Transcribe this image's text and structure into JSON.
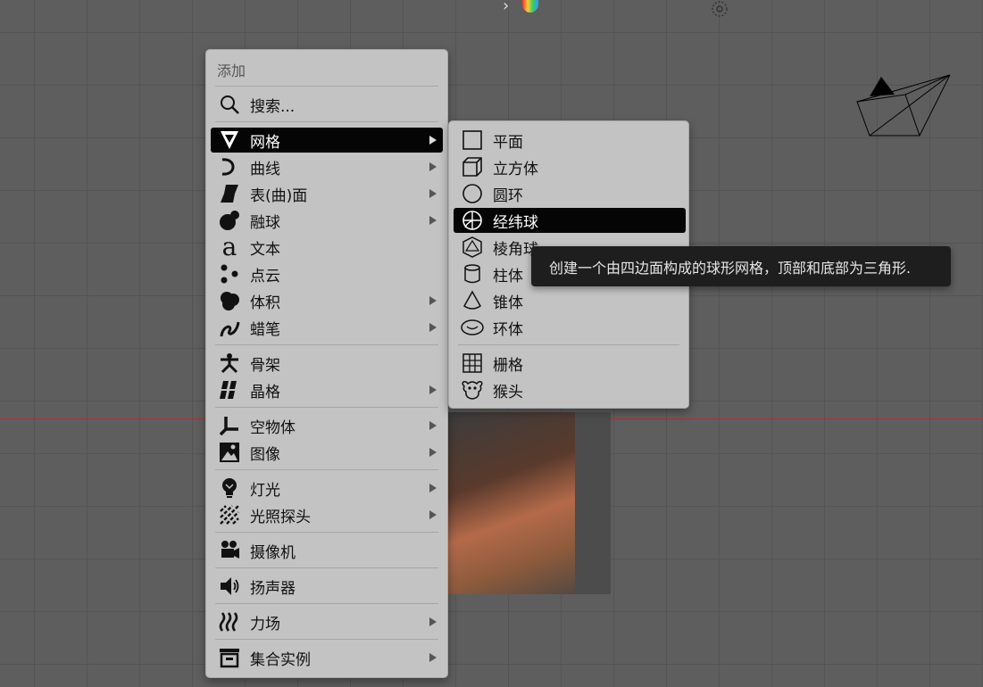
{
  "menu": {
    "header": "添加",
    "search_label": "搜索...",
    "items": [
      {
        "label": "网格",
        "icon": "mesh-icon",
        "submenu": true,
        "active": true
      },
      {
        "label": "曲线",
        "icon": "curve-icon",
        "submenu": true
      },
      {
        "label": "表(曲)面",
        "icon": "surface-icon",
        "submenu": true
      },
      {
        "label": "融球",
        "icon": "metaball-icon",
        "submenu": true
      },
      {
        "label": "文本",
        "icon": "text-icon",
        "submenu": false
      },
      {
        "label": "点云",
        "icon": "pointcloud-icon",
        "submenu": false
      },
      {
        "label": "体积",
        "icon": "volume-icon",
        "submenu": true
      },
      {
        "label": "蜡笔",
        "icon": "grease-pencil-icon",
        "submenu": true
      },
      {
        "label": "骨架",
        "icon": "armature-icon",
        "submenu": false
      },
      {
        "label": "晶格",
        "icon": "lattice-icon",
        "submenu": true
      },
      {
        "label": "空物体",
        "icon": "empty-icon",
        "submenu": true
      },
      {
        "label": "图像",
        "icon": "image-icon",
        "submenu": true
      },
      {
        "label": "灯光",
        "icon": "light-icon",
        "submenu": true
      },
      {
        "label": "光照探头",
        "icon": "light-probe-icon",
        "submenu": true
      },
      {
        "label": "摄像机",
        "icon": "camera-icon",
        "submenu": false
      },
      {
        "label": "扬声器",
        "icon": "speaker-icon",
        "submenu": false
      },
      {
        "label": "力场",
        "icon": "force-field-icon",
        "submenu": true
      },
      {
        "label": "集合实例",
        "icon": "collection-instance-icon",
        "submenu": true
      }
    ]
  },
  "submenu": {
    "items": [
      {
        "label": "平面",
        "icon": "plane-icon"
      },
      {
        "label": "立方体",
        "icon": "cube-icon"
      },
      {
        "label": "圆环",
        "icon": "circle-icon"
      },
      {
        "label": "经纬球",
        "icon": "uv-sphere-icon",
        "active": true
      },
      {
        "label": "棱角球",
        "icon": "ico-sphere-icon"
      },
      {
        "label": "柱体",
        "icon": "cylinder-icon"
      },
      {
        "label": "锥体",
        "icon": "cone-icon"
      },
      {
        "label": "环体",
        "icon": "torus-icon"
      },
      {
        "label": "栅格",
        "icon": "grid-icon"
      },
      {
        "label": "猴头",
        "icon": "monkey-icon"
      }
    ]
  },
  "tooltip": {
    "text": "创建一个由四边面构成的球形网格，顶部和底部为三角形."
  },
  "colors": {
    "menu_bg": "#c3c3c3",
    "active_bg": "#050505",
    "tooltip_bg": "#1e1e1e",
    "viewport_bg": "#5e5e5e",
    "x_axis": "#b03030"
  }
}
